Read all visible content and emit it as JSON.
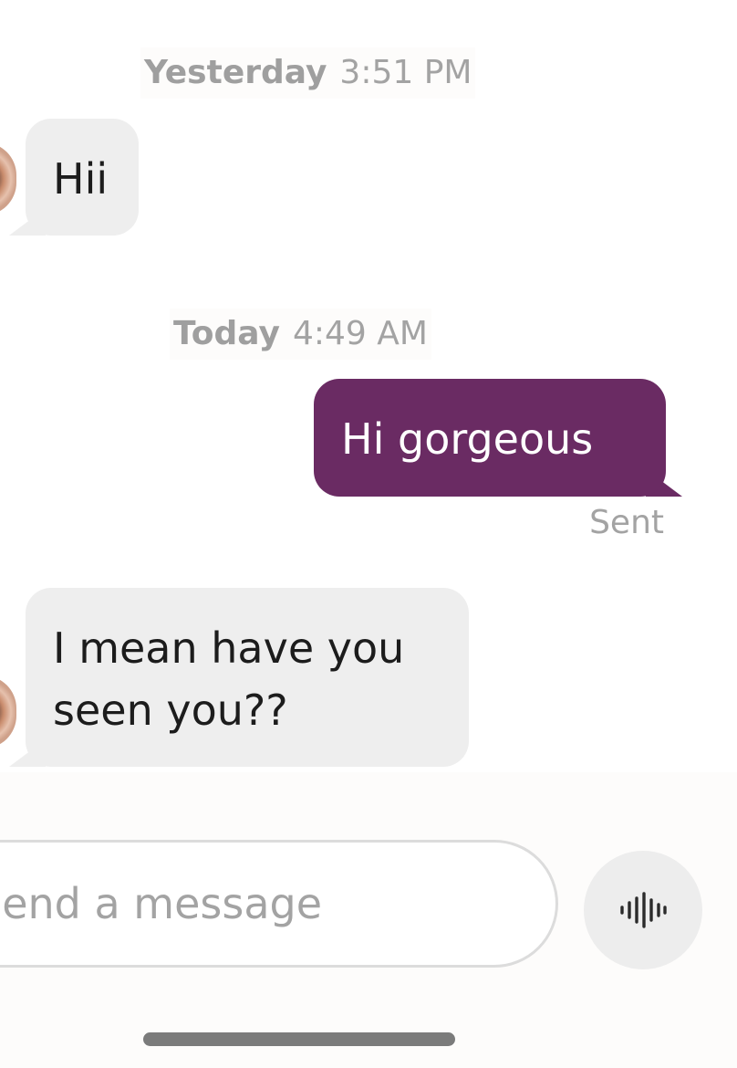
{
  "conversation": {
    "groups": [
      {
        "day": "Yesterday",
        "time": "3:51 PM",
        "messages": [
          {
            "direction": "incoming",
            "text": "Hii"
          }
        ]
      },
      {
        "day": "Today",
        "time": "4:49 AM",
        "messages": [
          {
            "direction": "outgoing",
            "text": "Hi gorgeous",
            "status": "Sent"
          },
          {
            "direction": "incoming",
            "text": "I mean have you seen you??"
          }
        ]
      }
    ]
  },
  "composer": {
    "placeholder": "Send a message",
    "voice_icon": "waveform-icon"
  },
  "colors": {
    "outgoing_bubble": "#6a2b63",
    "incoming_bubble": "#eeeeee",
    "muted_text": "#a3a3a3"
  }
}
